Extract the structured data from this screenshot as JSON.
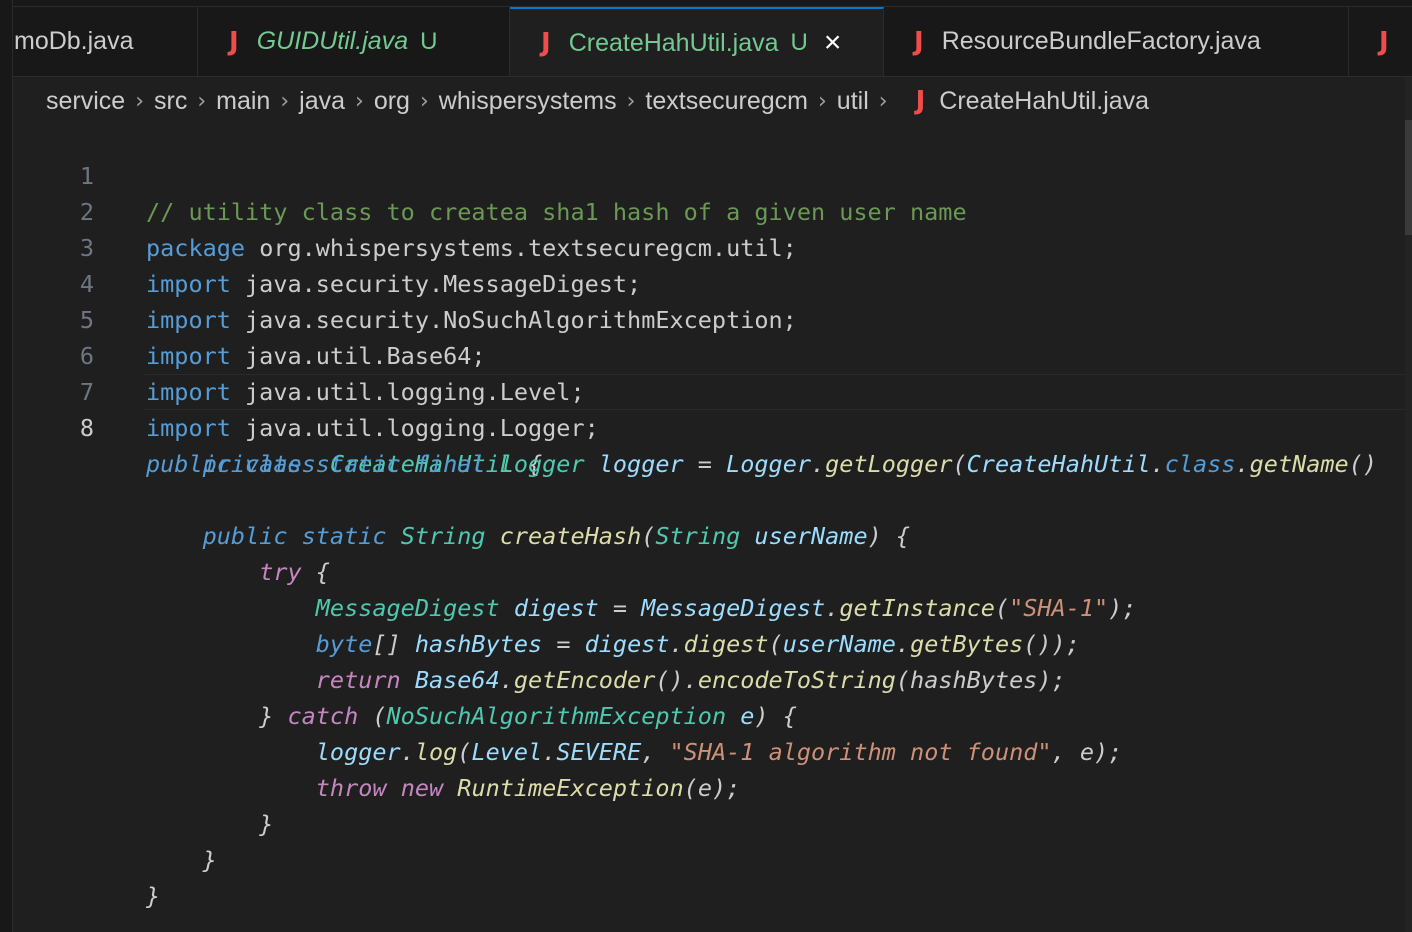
{
  "tabs": [
    {
      "name": "moDb.java",
      "status": "",
      "icon": "java-file-icon"
    },
    {
      "name": "GUIDUtil.java",
      "status": "U",
      "icon": "java-file-icon"
    },
    {
      "name": "CreateHahUtil.java",
      "status": "U",
      "icon": "java-file-icon",
      "active": true
    },
    {
      "name": "ResourceBundleFactory.java",
      "status": "",
      "icon": "java-file-icon"
    },
    {
      "name": "",
      "status": "",
      "icon": "java-file-icon"
    }
  ],
  "tab_icon_glyph": "J",
  "close_glyph": "×",
  "breadcrumbs": [
    "service",
    "src",
    "main",
    "java",
    "org",
    "whispersystems",
    "textsecuregcm",
    "util"
  ],
  "breadcrumb_file": "CreateHahUtil.java",
  "breadcrumb_separator": "›",
  "line_numbers": [
    "1",
    "2",
    "3",
    "4",
    "5",
    "6",
    "7",
    "8"
  ],
  "code": {
    "l1_comment": "// utility class to createa sha1 hash of a given user name",
    "l2_kw": "package",
    "l2_rest": " org.whispersystems.textsecuregcm.util;",
    "l3_kw": "import",
    "l3_rest": " java.security.MessageDigest;",
    "l4_kw": "import",
    "l4_rest": " java.security.NoSuchAlgorithmException;",
    "l5_kw": "import",
    "l5_rest": " java.util.Base64;",
    "l6_kw": "import",
    "l6_rest": " java.util.logging.Level;",
    "l7_kw": "import",
    "l7_rest": " java.util.logging.Logger;",
    "l8_public": "public",
    "l8_class": "class",
    "l8_name": "CreateHahUtil",
    "l8_brace": " {",
    "l9_mods": "private static final",
    "l9_type": "Logger",
    "l9_var": "logger",
    "l9_eq": " = ",
    "l9_cls": "Logger",
    "l9_dot": ".",
    "l9_fn": "getLogger",
    "l9_paren": "(",
    "l9_cls2": "CreateHahUtil",
    "l9_dot2": ".",
    "l9_kwclass": "class",
    "l9_dot3": ".",
    "l9_fn2": "getName",
    "l9_tail": "()",
    "l11_mods": "public static",
    "l11_type": "String",
    "l11_fn": "createHash",
    "l11_paren": "(",
    "l11_ptype": "String",
    "l11_pvar": "userName",
    "l11_tail": ") {",
    "l12_try": "try",
    "l12_brace": " {",
    "l13_type": "MessageDigest",
    "l13_var": "digest",
    "l13_eq": " = ",
    "l13_cls": "MessageDigest",
    "l13_dot": ".",
    "l13_fn": "getInstance",
    "l13_open": "(",
    "l13_str": "\"SHA-1\"",
    "l13_close": ");",
    "l14_type": "byte",
    "l14_arr": "[]",
    "l14_var": "hashBytes",
    "l14_eq": " = ",
    "l14_obj": "digest",
    "l14_dot": ".",
    "l14_fn": "digest",
    "l14_open": "(",
    "l14_arg": "userName",
    "l14_dot2": ".",
    "l14_fn2": "getBytes",
    "l14_close": "());",
    "l15_ret": "return",
    "l15_cls": "Base64",
    "l15_dot": ".",
    "l15_fn": "getEncoder",
    "l15_mid": "().",
    "l15_fn2": "encodeToString",
    "l15_open": "(",
    "l15_arg": "hashBytes",
    "l15_close": ");",
    "l16_close": "} ",
    "l16_catch": "catch",
    "l16_open": " (",
    "l16_type": "NoSuchAlgorithmException",
    "l16_var": "e",
    "l16_tail": ") {",
    "l17_obj": "logger",
    "l17_dot": ".",
    "l17_fn": "log",
    "l17_open": "(",
    "l17_cls": "Level",
    "l17_dot2": ".",
    "l17_const": "SEVERE",
    "l17_comma": ", ",
    "l17_str": "\"SHA-1 algorithm not found\"",
    "l17_tail": ", e);",
    "l18_throw": "throw",
    "l18_new": "new",
    "l18_type": "RuntimeException",
    "l18_tail": "(e);",
    "l19": "}",
    "l20": "}",
    "l21": "}"
  },
  "colors": {
    "keyword": "#569cd6",
    "control": "#c586c0",
    "type": "#4ec9b0",
    "function": "#dcdcaa",
    "variable": "#9cdcfe",
    "string": "#ce9178",
    "comment": "#6a9955",
    "untracked": "#73c991",
    "java_icon": "#f14c4c",
    "active_tab_border": "#0078d4"
  }
}
